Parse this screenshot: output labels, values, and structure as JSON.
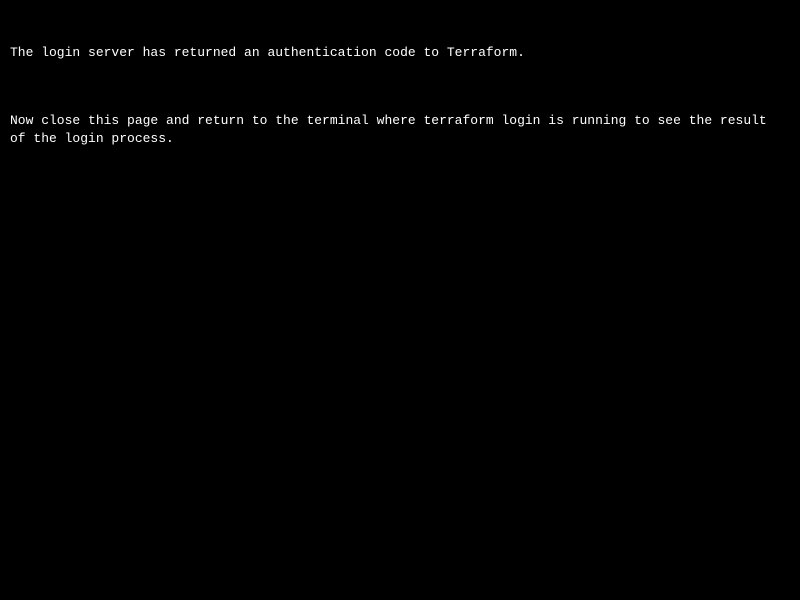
{
  "messages": {
    "line1": "The login server has returned an authentication code to Terraform.",
    "line2": "Now close this page and return to the terminal where terraform login is running to see the result of the login process."
  }
}
